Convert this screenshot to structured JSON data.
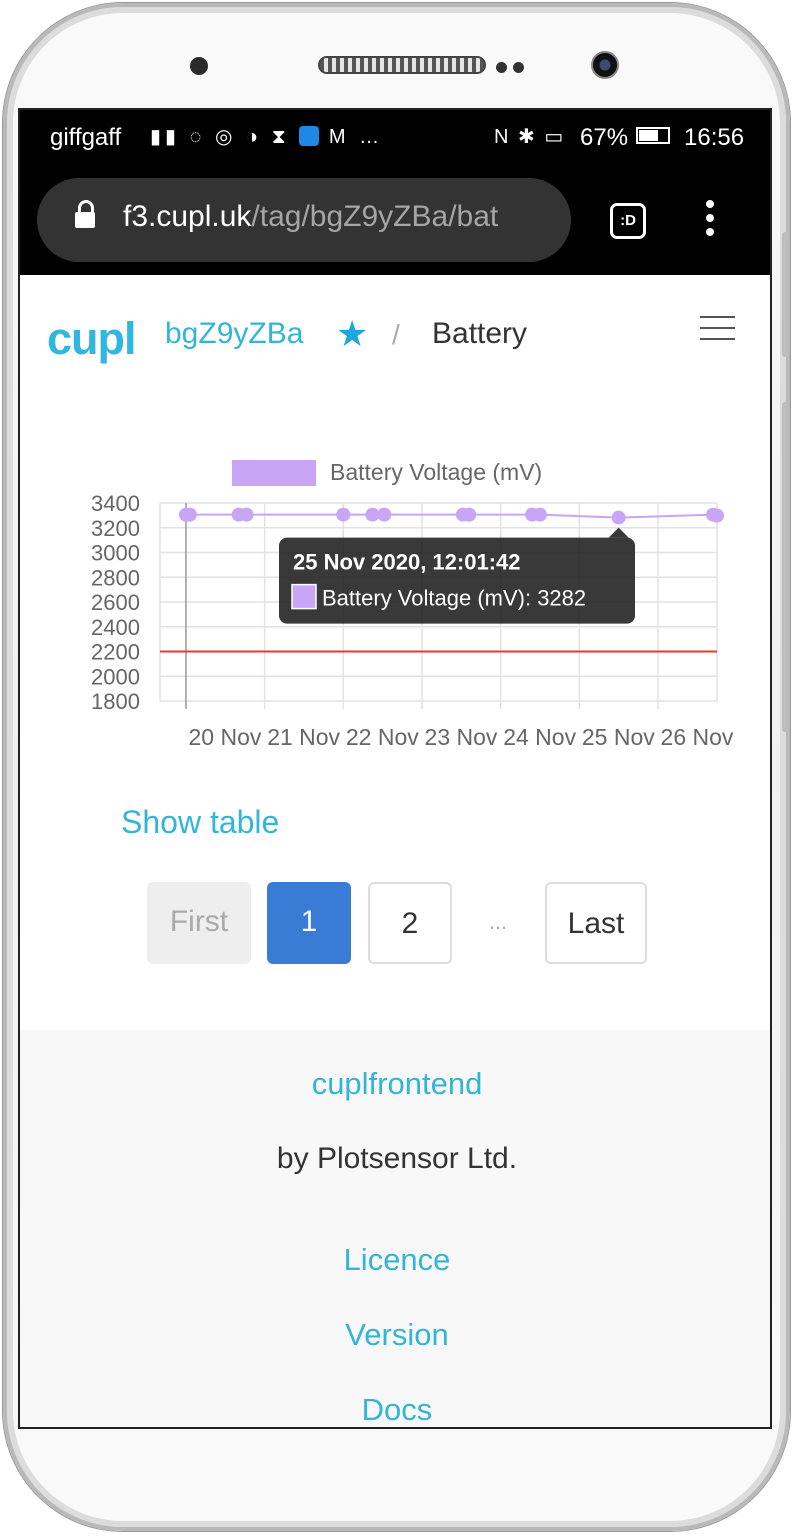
{
  "status_bar": {
    "carrier": "giffgaff",
    "left_icons": "▐▐ ◠ ◎ ◑ ⧗",
    "right_icons": "N ✱ ░",
    "battery_pct": "67%",
    "battery_level": 0.67,
    "time": "16:56",
    "more": "…"
  },
  "browser": {
    "url_host": "f3.cupl.uk",
    "url_path": "/tag/bgZ9yZBa/bat",
    "tabs_label": ":D"
  },
  "nav": {
    "logo": "cupl",
    "tag_id": "bgZ9yZBa",
    "star": "★",
    "separator": "/",
    "page": "Battery"
  },
  "chart_data": {
    "type": "line",
    "series": [
      {
        "name": "Battery Voltage (mV)",
        "color": "#c9a6f5",
        "points": [
          {
            "day": 20.0,
            "y": 3306
          },
          {
            "day": 20.05,
            "y": 3306
          },
          {
            "day": 20.67,
            "y": 3306
          },
          {
            "day": 20.77,
            "y": 3306
          },
          {
            "day": 22.0,
            "y": 3306
          },
          {
            "day": 22.37,
            "y": 3306
          },
          {
            "day": 22.52,
            "y": 3306
          },
          {
            "day": 23.52,
            "y": 3306
          },
          {
            "day": 23.6,
            "y": 3306
          },
          {
            "day": 24.4,
            "y": 3306
          },
          {
            "day": 24.5,
            "y": 3306
          },
          {
            "day": 25.5,
            "y": 3282
          },
          {
            "day": 26.7,
            "y": 3306
          },
          {
            "day": 26.75,
            "y": 3298
          }
        ]
      }
    ],
    "threshold": {
      "value": 2200,
      "color": "#e53935"
    },
    "x_ticks": [
      "20 Nov",
      "21 Nov",
      "22 Nov",
      "23 Nov",
      "24 Nov",
      "25 Nov",
      "26 Nov"
    ],
    "y_ticks": [
      "3400",
      "3200",
      "3000",
      "2800",
      "2600",
      "2400",
      "2200",
      "2000",
      "1800"
    ],
    "ylim": [
      1800,
      3400
    ],
    "xlim_days": [
      19.67,
      26.75
    ],
    "grid": true,
    "legend_position": "top",
    "tooltip": {
      "title": "25 Nov 2020, 12:01:42",
      "label": "Battery Voltage (mV): 3282"
    }
  },
  "show_table": "Show table",
  "pagination": {
    "first": "First",
    "current": "1",
    "next": "2",
    "ellipsis": "...",
    "last": "Last"
  },
  "footer": {
    "title": "cuplfrontend",
    "by": "by Plotsensor Ltd.",
    "links": [
      "Licence",
      "Version",
      "Docs"
    ]
  }
}
